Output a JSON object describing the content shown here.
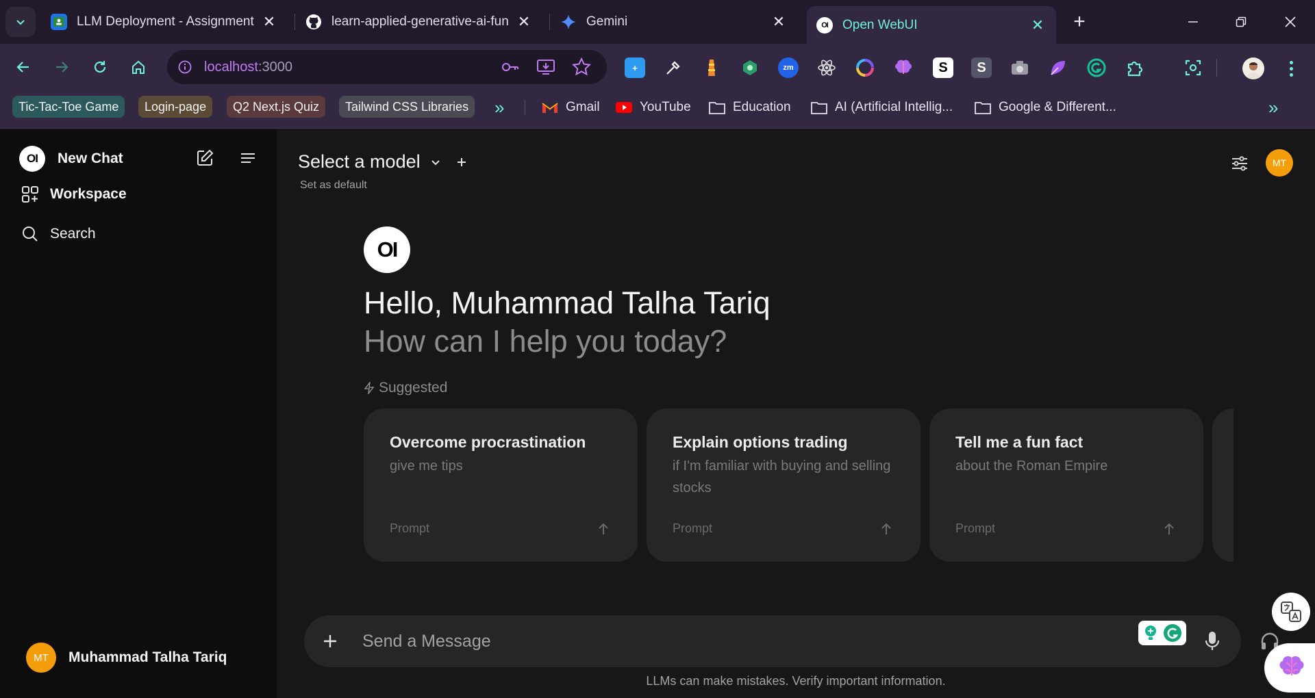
{
  "browser": {
    "tabs": [
      {
        "title": "LLM Deployment - Assignment",
        "icon": "google-classroom-icon",
        "active": false
      },
      {
        "title": "learn-applied-generative-ai-fun",
        "icon": "github-icon",
        "active": false
      },
      {
        "title": "Gemini",
        "icon": "gemini-icon",
        "active": false
      },
      {
        "title": "Open WebUI",
        "icon": "openwebui-icon",
        "active": true
      }
    ],
    "url_host": "localhost",
    "url_port": ":3000",
    "bookmark_chips": [
      {
        "label": "Tic-Tac-Toe Game",
        "color": "#2c5a5c"
      },
      {
        "label": "Login-page",
        "color": "#5b4a36"
      },
      {
        "label": "Q2 Next.js Quiz",
        "color": "#5a3a3c"
      },
      {
        "label": "Tailwind CSS Libraries",
        "color": "#4a4a52"
      }
    ],
    "bookmarks": [
      {
        "label": "Gmail",
        "icon": "gmail-icon"
      },
      {
        "label": "YouTube",
        "icon": "youtube-icon"
      },
      {
        "label": "Education",
        "icon": "folder-icon"
      },
      {
        "label": "AI (Artificial Intellig...",
        "icon": "folder-icon"
      },
      {
        "label": "Google & Different...",
        "icon": "folder-icon"
      }
    ],
    "accent": "#6ef2dc"
  },
  "sidebar": {
    "new_chat": "New Chat",
    "workspace": "Workspace",
    "search": "Search",
    "logo_text": "OI",
    "user_initials": "MT",
    "user_name": "Muhammad Talha Tariq"
  },
  "main": {
    "model_select": "Select a model",
    "set_default": "Set as default",
    "avatar_initials": "MT",
    "logo_text": "OI",
    "greeting": "Hello, Muhammad Talha Tariq",
    "subgreeting": "How can I help you today?",
    "suggested_label": "Suggested",
    "cards": [
      {
        "title": "Overcome procrastination",
        "subtitle": "give me tips",
        "prompt": "Prompt"
      },
      {
        "title": "Explain options trading",
        "subtitle": "if I'm familiar with buying and selling stocks",
        "prompt": "Prompt"
      },
      {
        "title": "Tell me a fun fact",
        "subtitle": "about the Roman Empire",
        "prompt": "Prompt"
      }
    ],
    "composer_placeholder": "Send a Message",
    "disclaimer": "LLMs can make mistakes. Verify important information."
  }
}
